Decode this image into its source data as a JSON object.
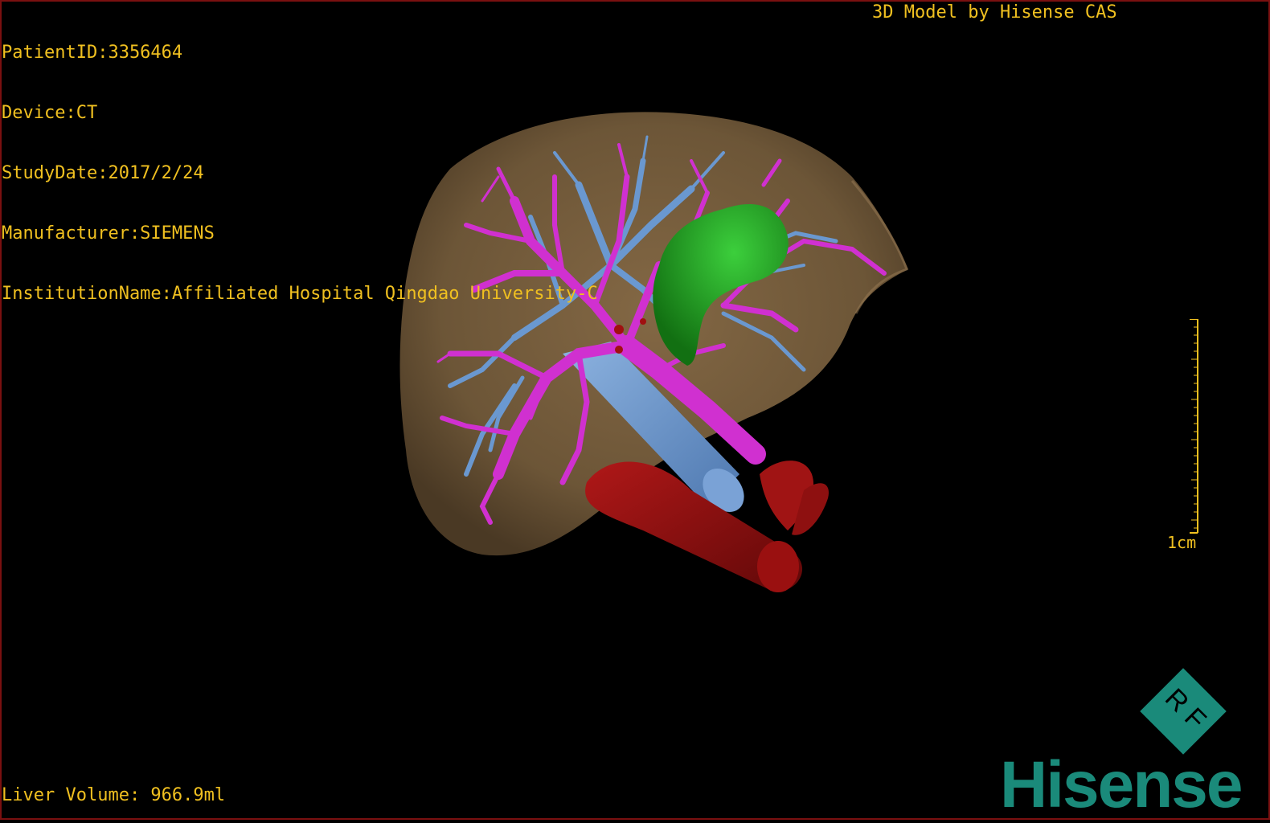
{
  "patient": {
    "id_line": "PatientID:3356464",
    "device_line": "Device:CT",
    "study_date_line": "StudyDate:2017/2/24",
    "manufacturer_line": "Manufacturer:SIEMENS",
    "institution_line": "InstitutionName:Affiliated Hospital Qingdao University-C"
  },
  "model_credit": "3D Model by Hisense CAS",
  "liver_volume": "Liver Volume: 966.9ml",
  "scale": {
    "label": "1cm"
  },
  "brand": {
    "badge": "R F",
    "name": "Hisense"
  },
  "colors": {
    "overlay_text": "#f0c020",
    "liver": "#7a6040",
    "portal_vein": "#d030d0",
    "hepatic_vein": "#6a98d0",
    "gallbladder": "#1f8f1f",
    "aorta_ivc": "#8a0c0c",
    "brand": "#1a8a7a"
  },
  "structures": [
    "liver",
    "portal-vein",
    "hepatic-vein",
    "gallbladder",
    "inferior-vena-cava",
    "aorta"
  ]
}
